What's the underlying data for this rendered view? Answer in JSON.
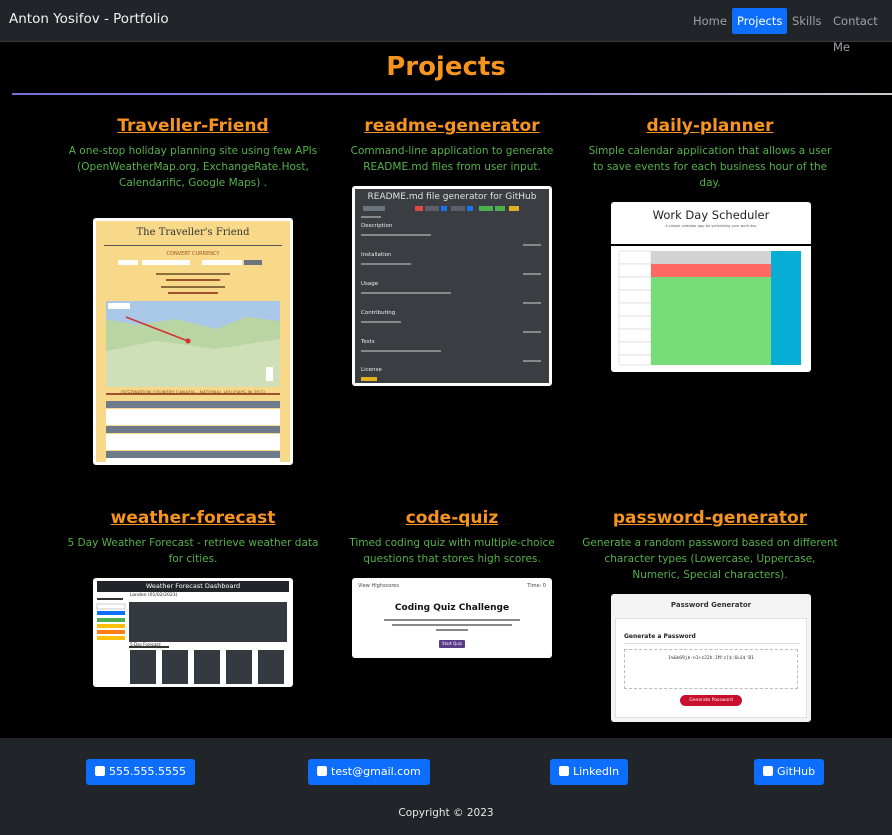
{
  "navbar": {
    "brand": "Anton Yosifov - Portfolio",
    "links": [
      "Home",
      "Projects",
      "Skills",
      "Contact Me"
    ],
    "active": "Projects"
  },
  "projects_section": {
    "title": "Projects",
    "cards": [
      {
        "title": "Traveller-Friend",
        "description": "A one-stop holiday planning site using few APIs (OpenWeatherMap.org, ExchangeRate.Host, Calendarific, Google Maps) ."
      },
      {
        "title": "readme-generator",
        "description": "Command-line application to generate README.md files from user input."
      },
      {
        "title": "daily-planner",
        "description": "Simple calendar application that allows a user to save events for each business hour of the day."
      },
      {
        "title": "weather-forecast",
        "description": "5 Day Weather Forecast - retrieve weather data for cities."
      },
      {
        "title": "code-quiz",
        "description": "Timed coding quiz with multiple-choice questions that stores high scores."
      },
      {
        "title": "password-generator",
        "description": "Generate a random password based on different character types (Lowercase, Uppercase, Numeric, Special characters)."
      }
    ]
  },
  "thumbnails": {
    "traveller": {
      "heading": "The Traveller's Friend",
      "sub": "CONVERT CURRENCY",
      "holidays": "DESTINATION COUNTRY CANADA - NATIONAL HOLIDAYS IN 2023"
    },
    "readme": {
      "heading": "README.md file generator for GitHub",
      "sections": [
        "Description",
        "Installation",
        "Usage",
        "Contributing",
        "Tests",
        "License"
      ]
    },
    "planner": {
      "heading": "Work Day Scheduler",
      "sub": "A simple calendar app for scheduling your work day"
    },
    "weather": {
      "heading": "Weather Forecast Dashboard",
      "city": "London (01/02/2023)",
      "forecast_label": "5-Day Forecast:"
    },
    "quiz": {
      "top_left": "View Highscores",
      "top_right": "Time: 0",
      "heading": "Coding Quiz Challenge",
      "button": "Start Quiz"
    },
    "password": {
      "heading": "Password Generator",
      "label": "Generate a Password",
      "value": "1%&b69j$-n1+z22h.1M!z[$:6L£$'B1",
      "button": "Generate Password"
    }
  },
  "footer": {
    "buttons": [
      {
        "label": "555.555.5555",
        "icon": "phone-icon"
      },
      {
        "label": "test@gmail.com",
        "icon": "envelope-icon"
      },
      {
        "label": "LinkedIn",
        "icon": "linkedin-icon"
      },
      {
        "label": "GitHub",
        "icon": "github-icon"
      }
    ],
    "copyright": "Copyright © 2023"
  },
  "colors": {
    "accent": "#f7941d",
    "desc": "#55b14a",
    "primary": "#0d6efd",
    "nav_bg": "#212529"
  }
}
